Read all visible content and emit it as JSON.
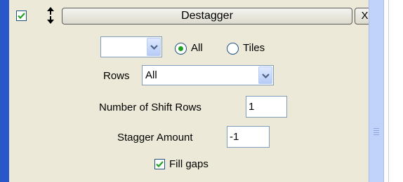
{
  "header": {
    "enabled_checked": true,
    "title": "Destagger",
    "close_label": "X"
  },
  "mode": {
    "selector_value": "",
    "options": [
      {
        "label": "All",
        "selected": true
      },
      {
        "label": "Tiles",
        "selected": false
      }
    ]
  },
  "rows": {
    "label": "Rows",
    "value": "All"
  },
  "shift_rows": {
    "label": "Number of Shift Rows",
    "value": "1"
  },
  "stagger": {
    "label": "Stagger Amount",
    "value": "-1"
  },
  "fill_gaps": {
    "label": "Fill gaps",
    "checked": true
  },
  "colors": {
    "panel": "#ece9d8",
    "accent_blue": "#2956c8",
    "check_green": "#21a121"
  },
  "icons": {
    "move": "up-down-arrows-icon",
    "check": "checkmark-icon",
    "dropdown": "chevron-down-icon"
  }
}
